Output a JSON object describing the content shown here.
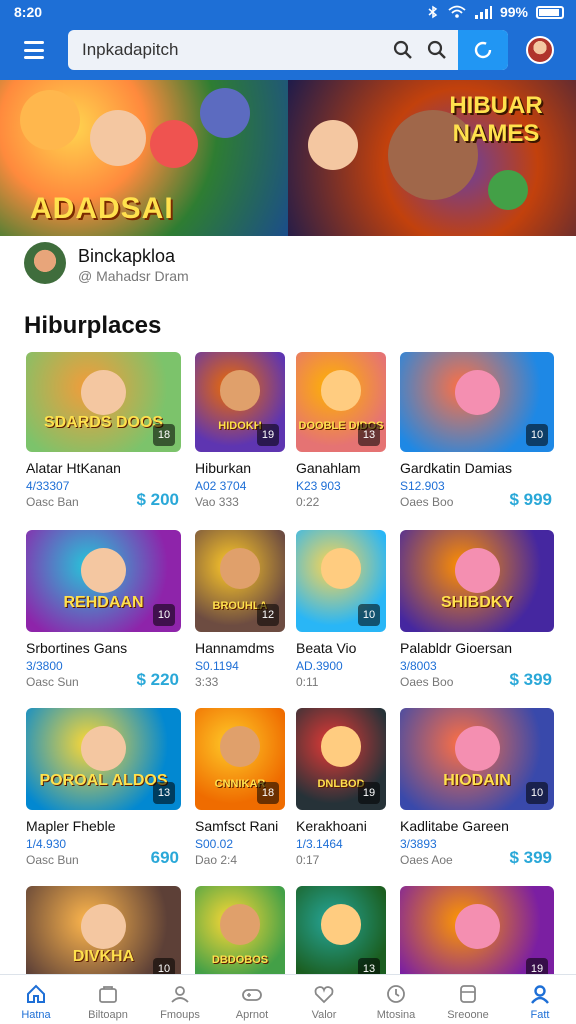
{
  "status": {
    "time": "8:20",
    "battery": "99%"
  },
  "search": {
    "value": "Inpkadapitch"
  },
  "banner": {
    "left_text": "ADADSAI",
    "right_text": "HIBUAR NAMES"
  },
  "developer": {
    "name": "Binckapkloa",
    "subtitle": "@ Mahadsr Dram"
  },
  "section_title": "Hiburplaces",
  "games": [
    {
      "title": "Alatar HtKanan",
      "meta": "4/33307",
      "meta2": "Oasc Ban",
      "price": "$ 200",
      "badge": "18",
      "thumb_text": "SDARDS DOOS"
    },
    {
      "title": "Hiburkan",
      "meta": "A02 3704",
      "meta2": "Vao 333",
      "price": "",
      "badge": "19",
      "thumb_text": "HIDOKH"
    },
    {
      "title": "Ganahlam",
      "meta": "K23 903",
      "meta2": "0:22",
      "price": "",
      "badge": "13",
      "thumb_text": "DOOBLE DIDOS"
    },
    {
      "title": "Gardkatin Damias",
      "meta": "S12.903",
      "meta2": "Oaes Boo",
      "price": "$ 999",
      "badge": "10",
      "thumb_text": ""
    },
    {
      "title": "Srbortines Gans",
      "meta": "3/3800",
      "meta2": "Oasc Sun",
      "price": "$ 220",
      "badge": "10",
      "thumb_text": "REHDAAN"
    },
    {
      "title": "Hannamdms",
      "meta": "S0.1194",
      "meta2": "3:33",
      "price": "",
      "badge": "12",
      "thumb_text": "BROUHLA"
    },
    {
      "title": "Beata Vio",
      "meta": "AD.3900",
      "meta2": "0:11",
      "price": "",
      "badge": "10",
      "thumb_text": ""
    },
    {
      "title": "Palabldr Gioersan",
      "meta": "3/8003",
      "meta2": "Oaes Boo",
      "price": "$ 399",
      "badge": "",
      "thumb_text": "SHIBDKY"
    },
    {
      "title": "Mapler Fheble",
      "meta": "1/4.930",
      "meta2": "Oasc Bun",
      "price": "690",
      "badge": "13",
      "thumb_text": "POROAL ALDOS"
    },
    {
      "title": "Samfsct Rani",
      "meta": "S00.02",
      "meta2": "Dao 2:4",
      "price": "",
      "badge": "18",
      "thumb_text": "CNNIKAR"
    },
    {
      "title": "Kerakhoani",
      "meta": "1/3.1464",
      "meta2": "0:17",
      "price": "",
      "badge": "19",
      "thumb_text": "DNLBOD"
    },
    {
      "title": "Kadlitabe Gareen",
      "meta": "3/3893",
      "meta2": "Oaes Aoe",
      "price": "$ 399",
      "badge": "10",
      "thumb_text": "HIODAIN"
    },
    {
      "title": "",
      "meta": "",
      "meta2": "",
      "price": "",
      "badge": "10",
      "thumb_text": "DIVKHA"
    },
    {
      "title": "",
      "meta": "",
      "meta2": "",
      "price": "",
      "badge": "",
      "thumb_text": "DBDOBOS"
    },
    {
      "title": "",
      "meta": "",
      "meta2": "",
      "price": "",
      "badge": "13",
      "thumb_text": ""
    },
    {
      "title": "",
      "meta": "",
      "meta2": "",
      "price": "",
      "badge": "19",
      "thumb_text": ""
    }
  ],
  "nav": [
    {
      "label": "Hatna",
      "icon": "home-icon"
    },
    {
      "label": "Biltoapn",
      "icon": "store-icon"
    },
    {
      "label": "Fmoups",
      "icon": "profile-icon"
    },
    {
      "label": "Aprnot",
      "icon": "gamepad-icon"
    },
    {
      "label": "Valor",
      "icon": "heart-icon"
    },
    {
      "label": "Mtosina",
      "icon": "clock-icon"
    },
    {
      "label": "Sreoone",
      "icon": "box-icon"
    },
    {
      "label": "Fatt",
      "icon": "user-icon"
    }
  ]
}
